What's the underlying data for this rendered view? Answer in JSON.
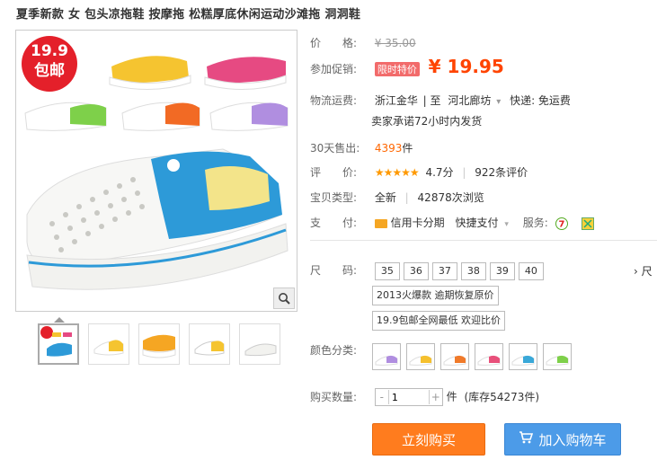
{
  "product": {
    "title": "夏季新款 女 包头凉拖鞋 按摩拖 松糕厚底休闲运动沙滩拖 洞洞鞋",
    "badge_price": "19.9",
    "badge_text": "包邮"
  },
  "price": {
    "label": "价　　格:",
    "original": "¥ 35.00",
    "promo_label": "参加促销:",
    "promo_badge": "限时特价",
    "current": "¥ 19.95"
  },
  "shipping": {
    "label": "物流运费:",
    "from": "浙江金华",
    "to_sep": "| 至",
    "to": "河北廊坊",
    "to_arrow": "▾",
    "fee": "快递: 免运费",
    "promise": "卖家承诺72小时内发货"
  },
  "sales": {
    "label": "30天售出:",
    "count": "4393",
    "unit": "件"
  },
  "rating": {
    "label": "评　　价:",
    "stars": "★★★★★",
    "score": "4.7分",
    "sep": "|",
    "reviews": "922条评价"
  },
  "status": {
    "label": "宝贝类型:",
    "condition": "全新",
    "sep": "|",
    "views": "42878次浏览"
  },
  "payment": {
    "label": "支　　付:",
    "credit": "信用卡分期",
    "quickpay": "快捷支付",
    "service_label": "服务:"
  },
  "size": {
    "label": "尺　　码:",
    "options": [
      "35",
      "36",
      "37",
      "38",
      "39",
      "40"
    ],
    "overflow": "› 尺"
  },
  "tags": [
    "2013火爆款 逾期恢复原价",
    "19.9包邮全网最低 欢迎比价"
  ],
  "color": {
    "label": "颜色分类:",
    "swatches": [
      "#b08ee0",
      "#f5c02e",
      "#f07a2a",
      "#e8507a",
      "#3aa8d8",
      "#7ed04a"
    ]
  },
  "quantity": {
    "label": "购买数量:",
    "minus": "-",
    "value": "1",
    "plus": "+",
    "unit": "件",
    "stock": "(库存54273件)"
  },
  "buttons": {
    "buy": "立刻购买",
    "cart": "加入购物车"
  },
  "colors": {
    "price_red": "#ff4400",
    "buy_orange": "#ff7c1e",
    "cart_blue": "#4c9be8"
  }
}
